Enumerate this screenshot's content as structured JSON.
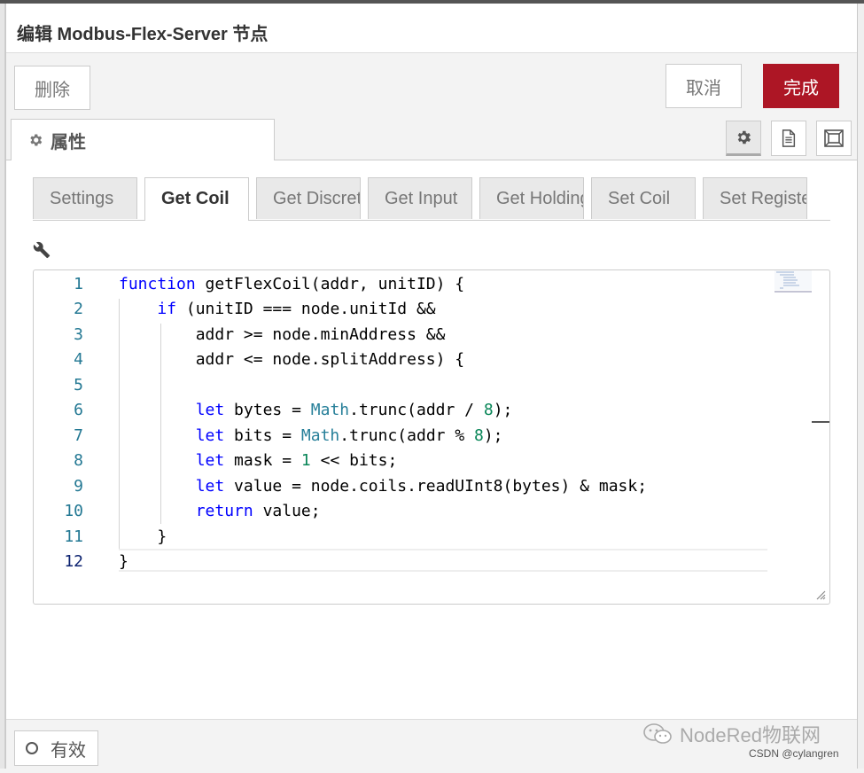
{
  "dialog": {
    "title": "编辑 Modbus-Flex-Server 节点"
  },
  "actions": {
    "delete_label": "删除",
    "cancel_label": "取消",
    "done_label": "完成"
  },
  "tabs": {
    "properties_label": "属性"
  },
  "subtabs": [
    {
      "label": "Settings",
      "active": false
    },
    {
      "label": "Get Coil",
      "active": true
    },
    {
      "label": "Get Discrete",
      "active": false
    },
    {
      "label": "Get Input",
      "active": false
    },
    {
      "label": "Get Holding",
      "active": false
    },
    {
      "label": "Set Coil",
      "active": false
    },
    {
      "label": "Set Register",
      "active": false
    }
  ],
  "editor": {
    "line_numbers": [
      "1",
      "2",
      "3",
      "4",
      "5",
      "6",
      "7",
      "8",
      "9",
      "10",
      "11",
      "12"
    ],
    "code_lines": [
      "function getFlexCoil(addr, unitID) {",
      "    if (unitID === node.unitId &&",
      "        addr >= node.minAddress &&",
      "        addr <= node.splitAddress) {",
      "",
      "        let bytes = Math.trunc(addr / 8);",
      "        let bits = Math.trunc(addr % 8);",
      "        let mask = 1 << bits;",
      "        let value = node.coils.readUInt8(bytes) & mask;",
      "        return value;",
      "    }",
      "}"
    ]
  },
  "footer": {
    "enabled_label": "有效"
  },
  "watermark": {
    "text": "NodeRed物联网",
    "credit": "CSDN @cylangren"
  },
  "icons": {
    "properties": "gear-icon",
    "description": "document-icon",
    "appearance": "frame-icon",
    "editor_tools": "wrench-icon",
    "resize": "resize-grip-icon"
  }
}
